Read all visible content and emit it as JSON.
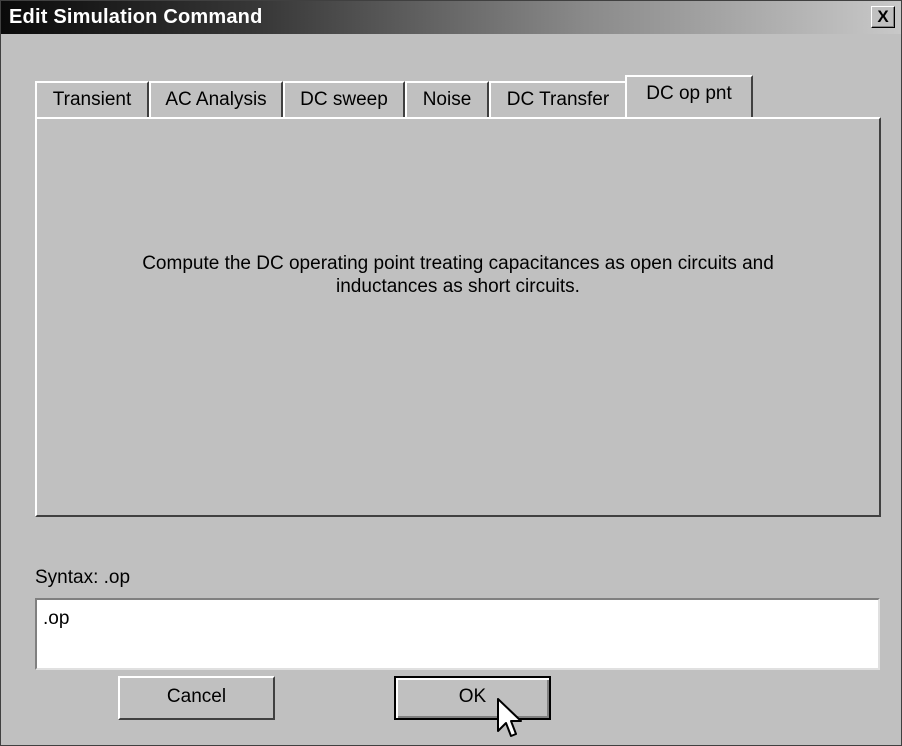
{
  "window": {
    "title": "Edit Simulation Command",
    "close_label": "X"
  },
  "tabs": [
    {
      "label": "Transient"
    },
    {
      "label": "AC Analysis"
    },
    {
      "label": "DC sweep"
    },
    {
      "label": "Noise"
    },
    {
      "label": "DC Transfer"
    },
    {
      "label": "DC op pnt",
      "active": true
    }
  ],
  "panel": {
    "description_line1": "Compute the DC operating point treating capacitances as open circuits and",
    "description_line2": "inductances as short circuits."
  },
  "syntax": {
    "label": "Syntax:  .op"
  },
  "command": {
    "value": ".op"
  },
  "buttons": {
    "cancel": "Cancel",
    "ok": "OK"
  },
  "cursor": {
    "icon": "arrow-pointer-icon"
  }
}
